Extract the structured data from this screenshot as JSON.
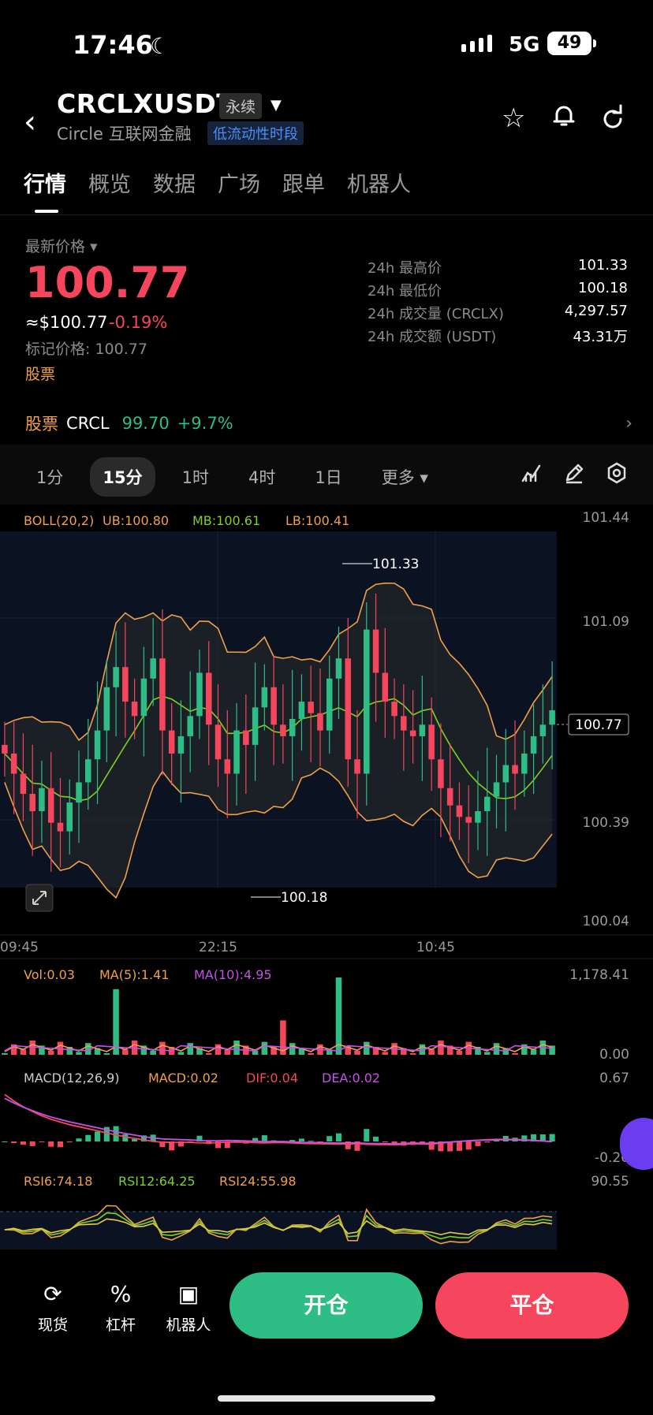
{
  "status_bar": {
    "time": "17:46",
    "network": "5G",
    "battery": "49"
  },
  "header": {
    "pair": "CRCLXUSDT",
    "contract_type": "永续",
    "subtitle": "Circle 互联网金融",
    "liquidity_badge": "低流动性时段"
  },
  "tabs": [
    "行情",
    "概览",
    "数据",
    "广场",
    "跟单",
    "机器人"
  ],
  "price": {
    "label": "最新价格",
    "last": "100.77",
    "usd": "≈$100.77",
    "change": "-0.19%",
    "mark_price": "标记价格: 100.77",
    "tag": "股票"
  },
  "stats": [
    {
      "k": "24h 最高价",
      "v": "101.33"
    },
    {
      "k": "24h 最低价",
      "v": "100.18"
    },
    {
      "k": "24h 成交量 (CRCLX)",
      "v": "4,297.57"
    },
    {
      "k": "24h 成交额 (USDT)",
      "v": "43.31万"
    }
  ],
  "stock_bar": {
    "tag": "股票",
    "symbol": "CRCL",
    "price": "99.70",
    "change": "+9.7%"
  },
  "intervals": [
    "1分",
    "15分",
    "1时",
    "4时",
    "1日",
    "更多"
  ],
  "active_interval": "15分",
  "chart_data": {
    "type": "candlestick",
    "boll": {
      "label": "BOLL(20,2)",
      "UB": "UB:100.80",
      "MB": "MB:100.61",
      "LB": "LB:100.41"
    },
    "y_axis": [
      "101.44",
      "101.09",
      "100.39",
      "100.04"
    ],
    "current_price": "100.77",
    "high_marker": "101.33",
    "low_marker": "100.18",
    "x_axis": [
      "09:45",
      "22:15",
      "10:45"
    ],
    "closes": [
      100.62,
      100.55,
      100.48,
      100.42,
      100.5,
      100.38,
      100.35,
      100.45,
      100.52,
      100.6,
      100.7,
      100.85,
      100.92,
      100.8,
      100.75,
      100.88,
      100.95,
      100.7,
      100.62,
      100.68,
      100.75,
      100.9,
      100.72,
      100.6,
      100.55,
      100.7,
      100.65,
      100.78,
      100.85,
      100.72,
      100.68,
      100.74,
      100.8,
      100.76,
      100.7,
      100.88,
      100.95,
      100.6,
      100.55,
      101.05,
      100.9,
      100.8,
      100.75,
      100.7,
      100.68,
      100.72,
      100.6,
      100.5,
      100.44,
      100.4,
      100.38,
      100.42,
      100.47,
      100.52,
      100.58,
      100.55,
      100.62,
      100.68,
      100.72,
      100.77
    ],
    "volume": {
      "label": "Vol:0.03",
      "ma5": "MA(5):1.41",
      "ma10": "MA(10):4.95",
      "max": "1,178.41",
      "min": "0.00"
    },
    "macd": {
      "label": "MACD(12,26,9)",
      "macd": "MACD:0.02",
      "dif": "DIF:0.04",
      "dea": "DEA:0.02",
      "max": "0.67",
      "min": "-0.26"
    },
    "rsi": {
      "rsi6": "RSI6:74.18",
      "rsi12": "RSI12:64.25",
      "rsi24": "RSI24:55.98",
      "max": "90.55"
    }
  },
  "bottom": {
    "spot": "现货",
    "leverage": "杠杆",
    "robot": "机器人",
    "open": "开仓",
    "close": "平仓"
  },
  "colors": {
    "up": "#2ebd85",
    "down": "#f6465d",
    "boll_ub": "#f0a04a",
    "boll_mb": "#7ed321",
    "macd_dea": "#c452e8"
  }
}
